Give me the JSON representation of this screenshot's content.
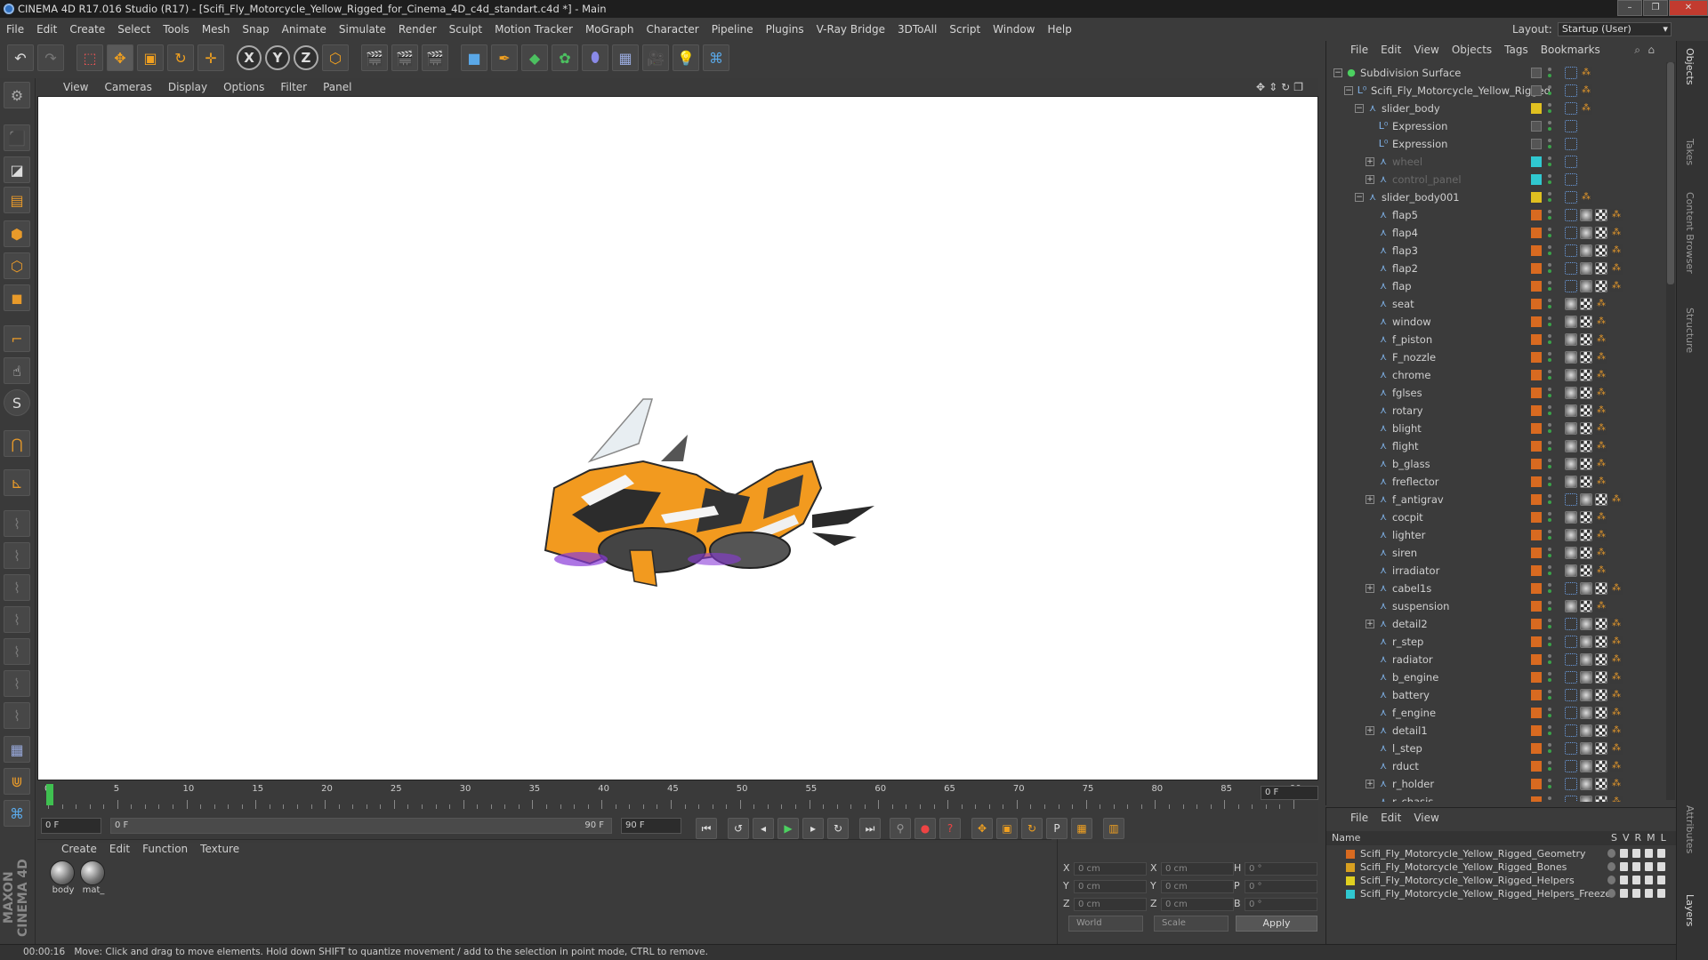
{
  "window": {
    "title": "CINEMA 4D R17.016 Studio (R17) - [Scifi_Fly_Motorcycle_Yellow_Rigged_for_Cinema_4D_c4d_standart.c4d *] - Main"
  },
  "menubar": [
    "File",
    "Edit",
    "Create",
    "Select",
    "Tools",
    "Mesh",
    "Snap",
    "Animate",
    "Simulate",
    "Render",
    "Sculpt",
    "Motion Tracker",
    "MoGraph",
    "Character",
    "Pipeline",
    "Plugins",
    "V-Ray Bridge",
    "3DToAll",
    "Script",
    "Window",
    "Help"
  ],
  "layout": {
    "label": "Layout:",
    "value": "Startup (User)"
  },
  "viewport": {
    "menu": [
      "View",
      "Cameras",
      "Display",
      "Options",
      "Filter",
      "Panel"
    ]
  },
  "timeline": {
    "ticks": [
      "0",
      "5",
      "10",
      "15",
      "20",
      "25",
      "30",
      "35",
      "40",
      "45",
      "50",
      "55",
      "60",
      "65",
      "70",
      "75",
      "80",
      "85",
      "90"
    ],
    "current_frame": "0 F",
    "start_field": "0 F",
    "range_start": "0 F",
    "range_end": "90 F",
    "end_field": "90 F"
  },
  "material_manager": {
    "menu": [
      "Create",
      "Edit",
      "Function",
      "Texture"
    ],
    "materials": [
      {
        "name": "body"
      },
      {
        "name": "mat_"
      }
    ]
  },
  "coordinates": {
    "pos": [
      {
        "axis": "X",
        "value": "0 cm"
      },
      {
        "axis": "Y",
        "value": "0 cm"
      },
      {
        "axis": "Z",
        "value": "0 cm"
      }
    ],
    "size": [
      {
        "axis": "X",
        "value": "0 cm"
      },
      {
        "axis": "Y",
        "value": "0 cm"
      },
      {
        "axis": "Z",
        "value": "0 cm"
      }
    ],
    "rot": [
      {
        "axis": "H",
        "value": "0 °"
      },
      {
        "axis": "P",
        "value": "0 °"
      },
      {
        "axis": "B",
        "value": "0 °"
      }
    ],
    "mode": "World",
    "scale_mode": "Scale",
    "apply_label": "Apply"
  },
  "status": {
    "time": "00:00:16",
    "message": "Move: Click and drag to move elements. Hold down SHIFT to quantize movement / add to the selection in point mode, CTRL to remove."
  },
  "object_manager": {
    "menu": [
      "File",
      "Edit",
      "View",
      "Objects",
      "Tags",
      "Bookmarks"
    ],
    "objects": [
      {
        "name": "Subdivision Surface",
        "color": "",
        "dim": false
      },
      {
        "name": "Scifi_Fly_Motorcycle_Yellow_Rigged",
        "color": "",
        "dim": false
      },
      {
        "name": "slider_body",
        "color": "#e0c020",
        "dim": false
      },
      {
        "name": "Expression",
        "color": "",
        "dim": false
      },
      {
        "name": "Expression",
        "color": "",
        "dim": false
      },
      {
        "name": "wheel",
        "color": "#30c8d0",
        "dim": true
      },
      {
        "name": "control_panel",
        "color": "#30c8d0",
        "dim": true
      },
      {
        "name": "slider_body001",
        "color": "#e0c020",
        "dim": false
      },
      {
        "name": "flap5",
        "color": "#d86a20",
        "dim": false
      },
      {
        "name": "flap4",
        "color": "#d86a20",
        "dim": false
      },
      {
        "name": "flap3",
        "color": "#d86a20",
        "dim": false
      },
      {
        "name": "flap2",
        "color": "#d86a20",
        "dim": false
      },
      {
        "name": "flap",
        "color": "#d86a20",
        "dim": false
      },
      {
        "name": "seat",
        "color": "#d86a20",
        "dim": false
      },
      {
        "name": "window",
        "color": "#d86a20",
        "dim": false
      },
      {
        "name": "f_piston",
        "color": "#d86a20",
        "dim": false
      },
      {
        "name": "F_nozzle",
        "color": "#d86a20",
        "dim": false
      },
      {
        "name": "chrome",
        "color": "#d86a20",
        "dim": false
      },
      {
        "name": "fglses",
        "color": "#d86a20",
        "dim": false
      },
      {
        "name": "rotary",
        "color": "#d86a20",
        "dim": false
      },
      {
        "name": "blight",
        "color": "#d86a20",
        "dim": false
      },
      {
        "name": "flight",
        "color": "#d86a20",
        "dim": false
      },
      {
        "name": "b_glass",
        "color": "#d86a20",
        "dim": false
      },
      {
        "name": "freflector",
        "color": "#d86a20",
        "dim": false
      },
      {
        "name": "f_antigrav",
        "color": "#d86a20",
        "dim": false
      },
      {
        "name": "cocpit",
        "color": "#d86a20",
        "dim": false
      },
      {
        "name": "lighter",
        "color": "#d86a20",
        "dim": false
      },
      {
        "name": "siren",
        "color": "#d86a20",
        "dim": false
      },
      {
        "name": "irradiator",
        "color": "#d86a20",
        "dim": false
      },
      {
        "name": "cabel1s",
        "color": "#d86a20",
        "dim": false
      },
      {
        "name": "suspension",
        "color": "#d86a20",
        "dim": false
      },
      {
        "name": "detail2",
        "color": "#d86a20",
        "dim": false
      },
      {
        "name": "r_step",
        "color": "#d86a20",
        "dim": false
      },
      {
        "name": "radiator",
        "color": "#d86a20",
        "dim": false
      },
      {
        "name": "b_engine",
        "color": "#d86a20",
        "dim": false
      },
      {
        "name": "battery",
        "color": "#d86a20",
        "dim": false
      },
      {
        "name": "f_engine",
        "color": "#d86a20",
        "dim": false
      },
      {
        "name": "detail1",
        "color": "#d86a20",
        "dim": false
      },
      {
        "name": "l_step",
        "color": "#d86a20",
        "dim": false
      },
      {
        "name": "rduct",
        "color": "#d86a20",
        "dim": false
      },
      {
        "name": "r_holder",
        "color": "#d86a20",
        "dim": false
      },
      {
        "name": "r_chasis",
        "color": "#d86a20",
        "dim": false
      }
    ]
  },
  "layer_manager": {
    "menu": [
      "File",
      "Edit",
      "View"
    ],
    "header": {
      "name": "Name",
      "cols": [
        "S",
        "V",
        "R",
        "M",
        "L"
      ]
    },
    "layers": [
      {
        "name": "Scifi_Fly_Motorcycle_Yellow_Rigged_Geometry",
        "color": "#d86a20"
      },
      {
        "name": "Scifi_Fly_Motorcycle_Yellow_Rigged_Bones",
        "color": "#d8a020"
      },
      {
        "name": "Scifi_Fly_Motorcycle_Yellow_Rigged_Helpers",
        "color": "#e0d020"
      },
      {
        "name": "Scifi_Fly_Motorcycle_Yellow_Rigged_Helpers_Freeze",
        "color": "#30c8d0"
      }
    ]
  },
  "side_tabs": [
    "Objects",
    "Takes",
    "Content Browser",
    "Structure",
    "Attributes",
    "Layers"
  ],
  "branding": {
    "text": "MAXON CINEMA 4D"
  }
}
